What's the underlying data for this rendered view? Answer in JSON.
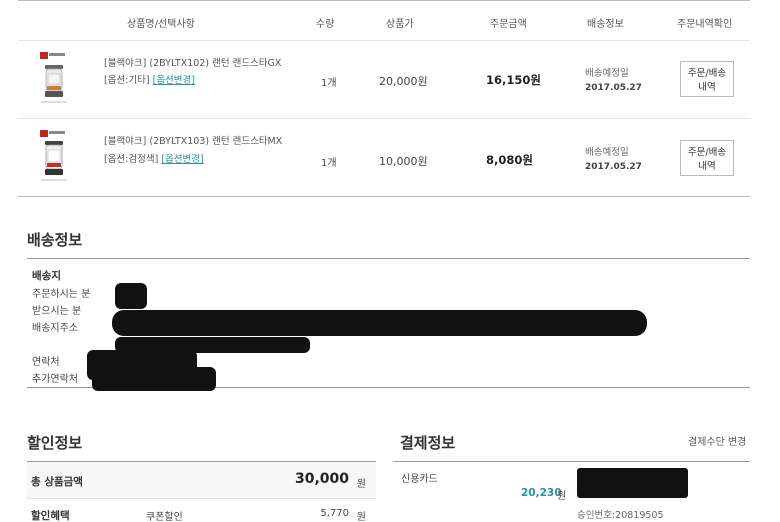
{
  "order": {
    "headers": {
      "product": "상품명/선택사항",
      "qty": "수량",
      "price": "상품가",
      "amount": "주문금액",
      "shipping": "배송정보",
      "confirm": "주문내역확인"
    },
    "items": [
      {
        "name": "[블랙야크] (2BYLTX102) 랜턴 랜드스타GX",
        "option_label": "[옵션:기타]",
        "option_change": "[옵션변경]",
        "qty": "1개",
        "price": "20,000원",
        "amount": "16,150원",
        "ship_status": "배송예정일",
        "ship_date": "2017.05.27",
        "button_line1": "주문/배송",
        "button_line2": "내역"
      },
      {
        "name": "[블랙야크] (2BYLTX103) 랜턴 랜드스타MX",
        "option_label": "[옵션:검정색]",
        "option_change": "[옵션변경]",
        "qty": "1개",
        "price": "10,000원",
        "amount": "8,080원",
        "ship_status": "배송예정일",
        "ship_date": "2017.05.27",
        "button_line1": "주문/배송",
        "button_line2": "내역"
      }
    ]
  },
  "shipping_info": {
    "title": "배송정보",
    "destination_label": "배송지",
    "orderer_label": "주문하시는 분",
    "recipient_label": "받으시는 분",
    "address_label": "배송지주소",
    "phone_label": "연락처",
    "extra_phone_label": "추가연락처"
  },
  "discount": {
    "title": "할인정보",
    "total_label": "총 상품금액",
    "total_value": "30,000",
    "total_unit": "원",
    "benefit_label": "할인혜택",
    "coupon_label": "쿠폰할인",
    "coupon_value": "5,770",
    "coupon_unit": "원"
  },
  "payment": {
    "title": "결제정보",
    "change_method": "결제수단 변경",
    "method": "신용카드",
    "amount": "20,230",
    "unit": "원",
    "approval": "승인번호:20819505"
  },
  "colors": {
    "link": "#2a8fa8",
    "redaction": "#111111",
    "border_strong": "#999999"
  }
}
